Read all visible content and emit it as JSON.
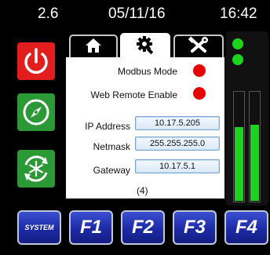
{
  "status": {
    "left_value": "2.6",
    "date": "05/11/16",
    "time": "16:42"
  },
  "tabs": [
    {
      "icon": "home-icon",
      "active": false
    },
    {
      "icon": "gear-icon",
      "active": true
    },
    {
      "icon": "tools-icon",
      "active": false
    }
  ],
  "side_buttons": [
    {
      "icon": "power-icon",
      "color": "#e11d1d"
    },
    {
      "icon": "compass-icon",
      "color": "#2b9a36"
    },
    {
      "icon": "snowflake-cycle-icon",
      "color": "#2b9a36"
    }
  ],
  "settings": {
    "modbus_label": "Modbus Mode",
    "web_remote_label": "Web Remote Enable",
    "ip_label": "IP Address",
    "ip_value": "10.17.5.205",
    "netmask_label": "Netmask",
    "netmask_value": "255.255.255.0",
    "gateway_label": "Gateway",
    "gateway_value": "10.17.5.1",
    "page_indicator": "(4)"
  },
  "meters": {
    "left_level": 0.67,
    "right_level": 0.69,
    "color": "#1ed31e"
  },
  "function_keys": [
    "SYSTEM",
    "F1",
    "F2",
    "F3",
    "F4"
  ]
}
